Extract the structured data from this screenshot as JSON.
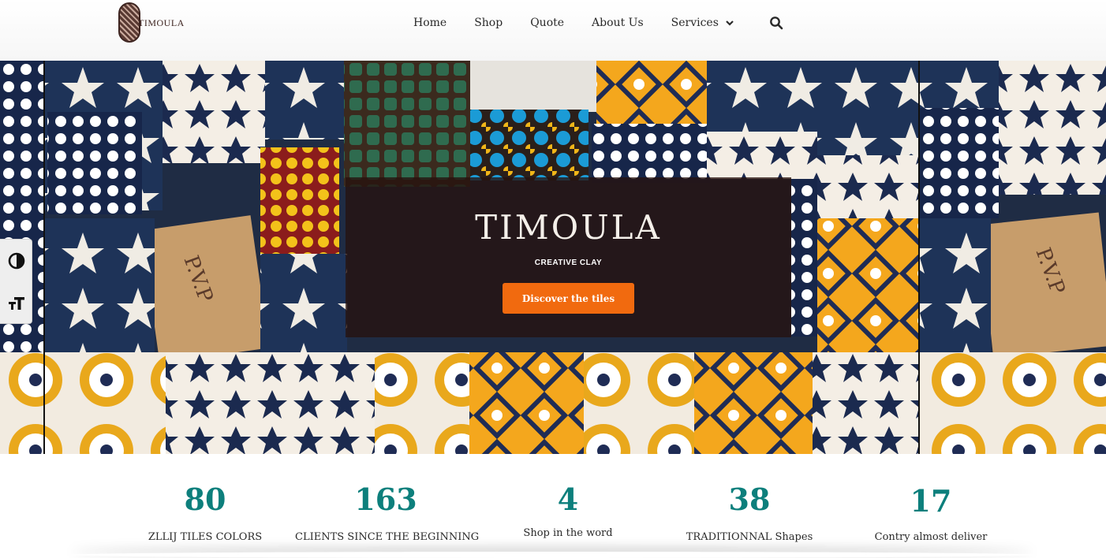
{
  "header": {
    "logo_text": "TIMOULA",
    "nav": [
      {
        "label": "Home"
      },
      {
        "label": "Shop"
      },
      {
        "label": "Quote"
      },
      {
        "label": "About Us"
      },
      {
        "label": "Services"
      }
    ],
    "services_icon": "chevron-down-icon",
    "search_icon": "search-icon"
  },
  "hero": {
    "title": "TIMOULA",
    "subtitle": "CREATIVE CLAY",
    "button_label": "Discover the tiles"
  },
  "accessibility": {
    "contrast_icon": "contrast-icon",
    "font_size_icon": "font-size-icon"
  },
  "stats": [
    {
      "number": "80",
      "label": "ZLLIJ TILES COLORS"
    },
    {
      "number": "163",
      "label": "CLIENTS SINCE THE BEGINNING"
    },
    {
      "number": "4",
      "label": "Shop in the word"
    },
    {
      "number": "38",
      "label": "TRADITIONNAL Shapes"
    },
    {
      "number": "17",
      "label": "Contry almost deliver"
    }
  ],
  "colors": {
    "accent_orange": "#f16a0f",
    "stat_teal": "#0d7f7c",
    "overlay": "#26120e"
  }
}
